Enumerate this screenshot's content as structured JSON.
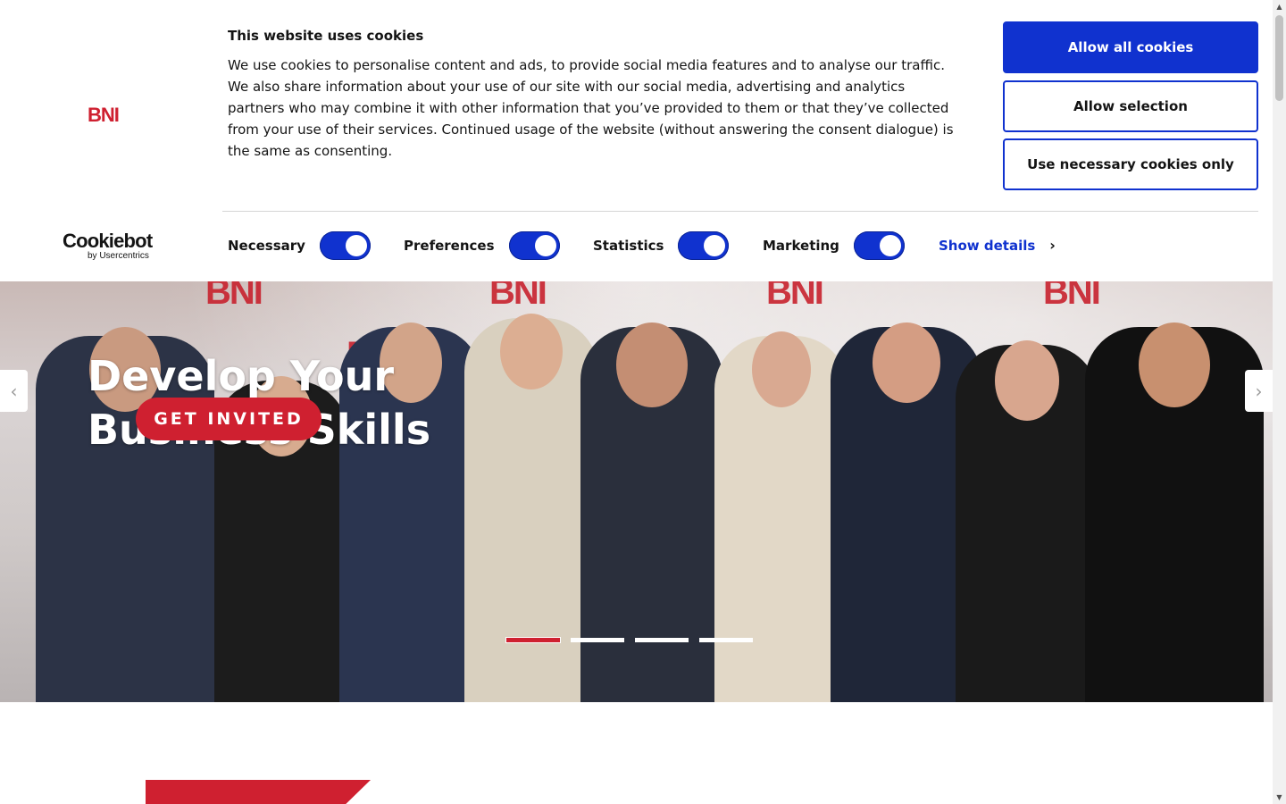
{
  "cookie_banner": {
    "logo_text": "BNI",
    "title": "This website uses cookies",
    "body": "We use cookies to personalise content and ads, to provide social media features and to analyse our traffic. We also share information about your use of our site with our social media, advertising and analytics partners who may combine it with other information that you’ve provided to them or that they’ve collected from your use of their services. Continued usage of the website (without answering the consent dialogue) is the same as consenting.",
    "buttons": {
      "allow_all": "Allow all cookies",
      "allow_selection": "Allow selection",
      "necessary_only": "Use necessary cookies only"
    },
    "provider": {
      "name": "Cookiebot",
      "by": "by Usercentrics"
    },
    "toggles": [
      {
        "label": "Necessary",
        "checked": true
      },
      {
        "label": "Preferences",
        "checked": true
      },
      {
        "label": "Statistics",
        "checked": true
      },
      {
        "label": "Marketing",
        "checked": true
      }
    ],
    "show_details": "Show details",
    "accent_color": "#1032cf"
  },
  "hero": {
    "heading": "Develop Your Business Skills",
    "cta": "GET INVITED",
    "brand_text": "BNI",
    "slides_count": 4,
    "active_slide": 1,
    "prev_icon": "chevron-left-icon",
    "next_icon": "chevron-right-icon",
    "accent_color": "#cf2030"
  }
}
